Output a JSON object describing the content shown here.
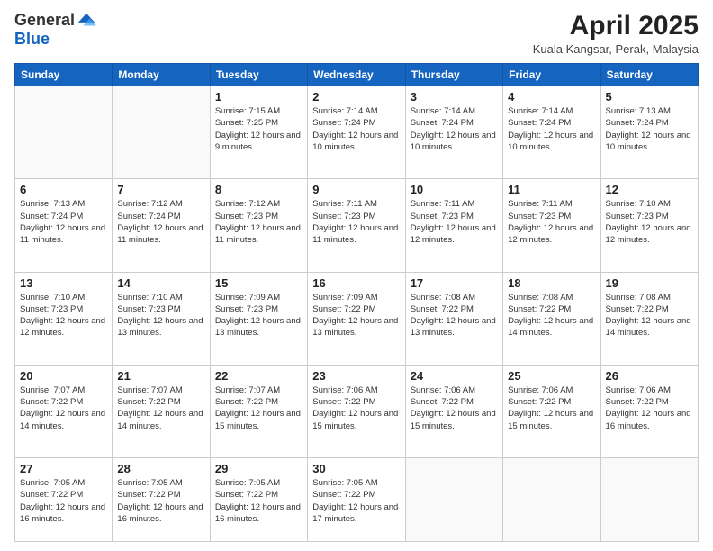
{
  "header": {
    "logo_general": "General",
    "logo_blue": "Blue",
    "month_title": "April 2025",
    "location": "Kuala Kangsar, Perak, Malaysia"
  },
  "weekdays": [
    "Sunday",
    "Monday",
    "Tuesday",
    "Wednesday",
    "Thursday",
    "Friday",
    "Saturday"
  ],
  "weeks": [
    [
      {
        "day": "",
        "info": ""
      },
      {
        "day": "",
        "info": ""
      },
      {
        "day": "1",
        "info": "Sunrise: 7:15 AM\nSunset: 7:25 PM\nDaylight: 12 hours and 9 minutes."
      },
      {
        "day": "2",
        "info": "Sunrise: 7:14 AM\nSunset: 7:24 PM\nDaylight: 12 hours and 10 minutes."
      },
      {
        "day": "3",
        "info": "Sunrise: 7:14 AM\nSunset: 7:24 PM\nDaylight: 12 hours and 10 minutes."
      },
      {
        "day": "4",
        "info": "Sunrise: 7:14 AM\nSunset: 7:24 PM\nDaylight: 12 hours and 10 minutes."
      },
      {
        "day": "5",
        "info": "Sunrise: 7:13 AM\nSunset: 7:24 PM\nDaylight: 12 hours and 10 minutes."
      }
    ],
    [
      {
        "day": "6",
        "info": "Sunrise: 7:13 AM\nSunset: 7:24 PM\nDaylight: 12 hours and 11 minutes."
      },
      {
        "day": "7",
        "info": "Sunrise: 7:12 AM\nSunset: 7:24 PM\nDaylight: 12 hours and 11 minutes."
      },
      {
        "day": "8",
        "info": "Sunrise: 7:12 AM\nSunset: 7:23 PM\nDaylight: 12 hours and 11 minutes."
      },
      {
        "day": "9",
        "info": "Sunrise: 7:11 AM\nSunset: 7:23 PM\nDaylight: 12 hours and 11 minutes."
      },
      {
        "day": "10",
        "info": "Sunrise: 7:11 AM\nSunset: 7:23 PM\nDaylight: 12 hours and 12 minutes."
      },
      {
        "day": "11",
        "info": "Sunrise: 7:11 AM\nSunset: 7:23 PM\nDaylight: 12 hours and 12 minutes."
      },
      {
        "day": "12",
        "info": "Sunrise: 7:10 AM\nSunset: 7:23 PM\nDaylight: 12 hours and 12 minutes."
      }
    ],
    [
      {
        "day": "13",
        "info": "Sunrise: 7:10 AM\nSunset: 7:23 PM\nDaylight: 12 hours and 12 minutes."
      },
      {
        "day": "14",
        "info": "Sunrise: 7:10 AM\nSunset: 7:23 PM\nDaylight: 12 hours and 13 minutes."
      },
      {
        "day": "15",
        "info": "Sunrise: 7:09 AM\nSunset: 7:23 PM\nDaylight: 12 hours and 13 minutes."
      },
      {
        "day": "16",
        "info": "Sunrise: 7:09 AM\nSunset: 7:22 PM\nDaylight: 12 hours and 13 minutes."
      },
      {
        "day": "17",
        "info": "Sunrise: 7:08 AM\nSunset: 7:22 PM\nDaylight: 12 hours and 13 minutes."
      },
      {
        "day": "18",
        "info": "Sunrise: 7:08 AM\nSunset: 7:22 PM\nDaylight: 12 hours and 14 minutes."
      },
      {
        "day": "19",
        "info": "Sunrise: 7:08 AM\nSunset: 7:22 PM\nDaylight: 12 hours and 14 minutes."
      }
    ],
    [
      {
        "day": "20",
        "info": "Sunrise: 7:07 AM\nSunset: 7:22 PM\nDaylight: 12 hours and 14 minutes."
      },
      {
        "day": "21",
        "info": "Sunrise: 7:07 AM\nSunset: 7:22 PM\nDaylight: 12 hours and 14 minutes."
      },
      {
        "day": "22",
        "info": "Sunrise: 7:07 AM\nSunset: 7:22 PM\nDaylight: 12 hours and 15 minutes."
      },
      {
        "day": "23",
        "info": "Sunrise: 7:06 AM\nSunset: 7:22 PM\nDaylight: 12 hours and 15 minutes."
      },
      {
        "day": "24",
        "info": "Sunrise: 7:06 AM\nSunset: 7:22 PM\nDaylight: 12 hours and 15 minutes."
      },
      {
        "day": "25",
        "info": "Sunrise: 7:06 AM\nSunset: 7:22 PM\nDaylight: 12 hours and 15 minutes."
      },
      {
        "day": "26",
        "info": "Sunrise: 7:06 AM\nSunset: 7:22 PM\nDaylight: 12 hours and 16 minutes."
      }
    ],
    [
      {
        "day": "27",
        "info": "Sunrise: 7:05 AM\nSunset: 7:22 PM\nDaylight: 12 hours and 16 minutes."
      },
      {
        "day": "28",
        "info": "Sunrise: 7:05 AM\nSunset: 7:22 PM\nDaylight: 12 hours and 16 minutes."
      },
      {
        "day": "29",
        "info": "Sunrise: 7:05 AM\nSunset: 7:22 PM\nDaylight: 12 hours and 16 minutes."
      },
      {
        "day": "30",
        "info": "Sunrise: 7:05 AM\nSunset: 7:22 PM\nDaylight: 12 hours and 17 minutes."
      },
      {
        "day": "",
        "info": ""
      },
      {
        "day": "",
        "info": ""
      },
      {
        "day": "",
        "info": ""
      }
    ]
  ]
}
